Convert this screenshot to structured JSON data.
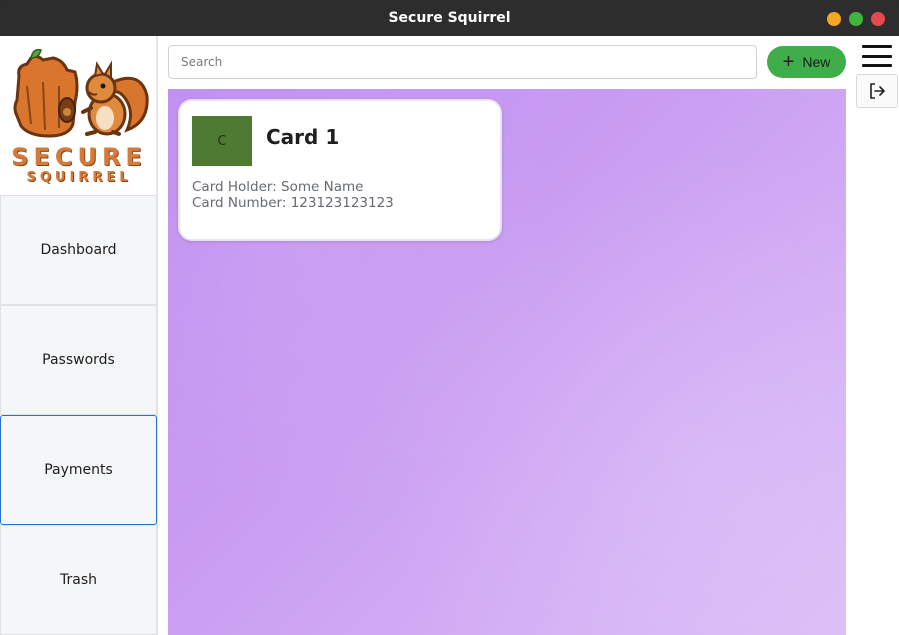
{
  "window": {
    "title": "Secure Squirrel",
    "controls": {
      "minimize_color": "#f5a623",
      "maximize_color": "#3fb43f",
      "close_color": "#e5484d"
    }
  },
  "logo": {
    "line1": "SECURE",
    "line2": "SQUIRREL"
  },
  "sidebar": {
    "items": [
      {
        "label": "Dashboard"
      },
      {
        "label": "Passwords"
      },
      {
        "label": "Payments"
      },
      {
        "label": "Trash"
      }
    ],
    "active": "Payments"
  },
  "toolbar": {
    "search_placeholder": "Search",
    "search_value": "",
    "new_label": "New",
    "new_icon": "plus-icon",
    "menu_icon": "hamburger-menu-icon",
    "logout_icon": "logout-icon",
    "accent": "#3fae4a"
  },
  "cards": [
    {
      "avatar_letter": "C",
      "avatar_color": "#4f7a31",
      "title": "Card 1",
      "holder_line": "Card Holder: Some Name",
      "number_line": "Card Number: 123123123123"
    }
  ]
}
